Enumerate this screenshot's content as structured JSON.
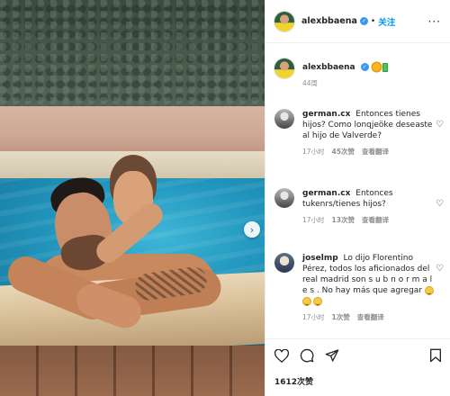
{
  "post": {
    "username": "alexbbaena",
    "follow_label": "关注",
    "more_label": "···",
    "caption_time": "44周",
    "likes": "1612次赞"
  },
  "comments": [
    {
      "username": "german.cx",
      "text": "Entonces tienes hijos? Como lonqjeöke deseaste al hijo de Valverde?",
      "time": "17小时",
      "likes": "45次赞",
      "translate": "查看翻译"
    },
    {
      "username": "german.cx",
      "text": "Entonces tukenrs/tienes hijos?",
      "time": "17小时",
      "likes": "13次赞",
      "translate": "查看翻译"
    },
    {
      "username": "joselmp",
      "text": "Lo dijo Florentino Pérez, todos los aficionados del real madrid son s u b n o r m a l e s . No hay más que agregar",
      "time": "17小时",
      "likes": "1次赞",
      "translate": "查看翻译"
    }
  ],
  "icons": [
    "heart-icon",
    "comment-icon",
    "share-icon",
    "bookmark-icon",
    "chevron-right-icon",
    "verified-icon"
  ],
  "colors": {
    "accent": "#0095f6",
    "verified": "#3897f0",
    "muted": "#8e8e8e"
  }
}
